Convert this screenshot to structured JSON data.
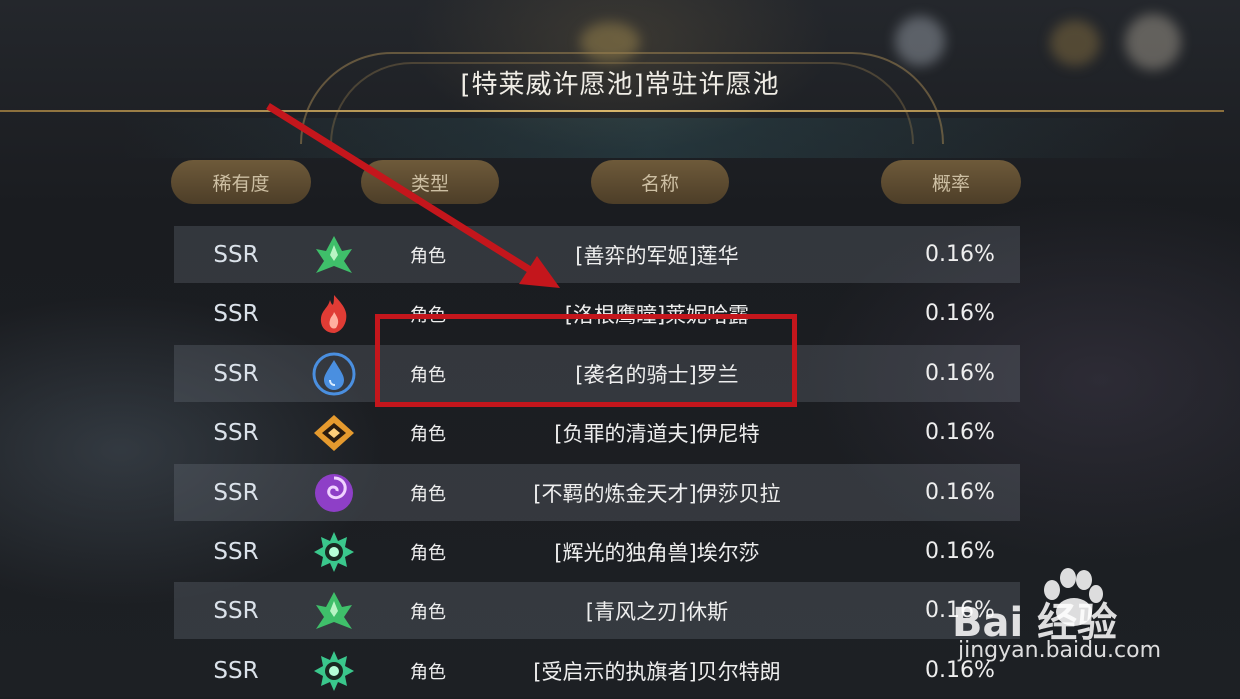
{
  "title": "[特莱威许愿池]常驻许愿池",
  "headers": {
    "rarity": "稀有度",
    "type": "类型",
    "name": "名称",
    "rate": "概率"
  },
  "rows": [
    {
      "rarity": "SSR",
      "icon": "anemo-element-icon",
      "type": "角色",
      "name": "[善弈的军姬]莲华",
      "rate": "0.16%"
    },
    {
      "rarity": "SSR",
      "icon": "pyro-element-icon",
      "type": "角色",
      "name": "[洛根鹰瞳]莱妮哈露",
      "rate": "0.16%"
    },
    {
      "rarity": "SSR",
      "icon": "hydro-element-icon",
      "type": "角色",
      "name": "[袭名的骑士]罗兰",
      "rate": "0.16%"
    },
    {
      "rarity": "SSR",
      "icon": "geo-element-icon",
      "type": "角色",
      "name": "[负罪的清道夫]伊尼特",
      "rate": "0.16%"
    },
    {
      "rarity": "SSR",
      "icon": "void-element-icon",
      "type": "角色",
      "name": "[不羁的炼金天才]伊莎贝拉",
      "rate": "0.16%"
    },
    {
      "rarity": "SSR",
      "icon": "light-element-icon",
      "type": "角色",
      "name": "[辉光的独角兽]埃尔莎",
      "rate": "0.16%"
    },
    {
      "rarity": "SSR",
      "icon": "anemo-element-icon",
      "type": "角色",
      "name": "[青风之刃]休斯",
      "rate": "0.16%"
    },
    {
      "rarity": "SSR",
      "icon": "light-element-icon",
      "type": "角色",
      "name": "[受启示的执旗者]贝尔特朗",
      "rate": "0.16%"
    }
  ],
  "watermark": {
    "logo": "Bai 经验",
    "url": "jingyan.baidu.com"
  },
  "colors": {
    "highlight": "#c4161c",
    "gold": "#d8b56a"
  }
}
